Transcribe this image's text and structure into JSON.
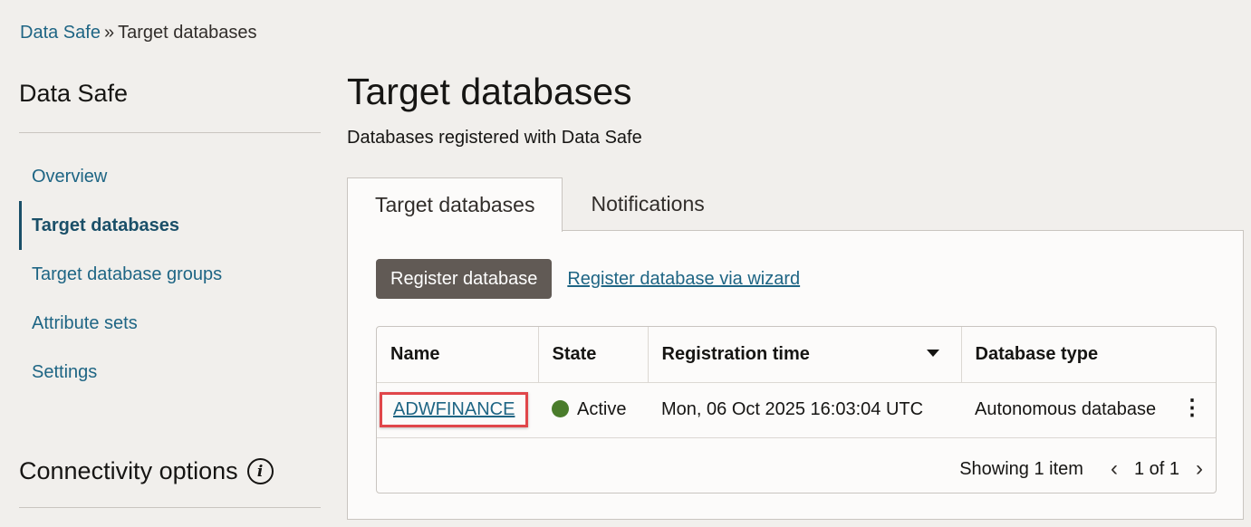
{
  "breadcrumb": {
    "parent": "Data Safe",
    "separator": "»",
    "current": "Target databases"
  },
  "sidebar": {
    "title": "Data Safe",
    "items": [
      {
        "label": "Overview",
        "active": false
      },
      {
        "label": "Target databases",
        "active": true
      },
      {
        "label": "Target database groups",
        "active": false
      },
      {
        "label": "Attribute sets",
        "active": false
      },
      {
        "label": "Settings",
        "active": false
      }
    ],
    "connectivity_title": "Connectivity options",
    "info_icon": "i"
  },
  "main": {
    "title": "Target databases",
    "subtitle": "Databases registered with Data Safe",
    "tabs": [
      {
        "label": "Target databases",
        "active": true
      },
      {
        "label": "Notifications",
        "active": false
      }
    ],
    "actions": {
      "register_button": "Register database",
      "wizard_link": "Register database via wizard"
    },
    "table": {
      "columns": [
        "Name",
        "State",
        "Registration time",
        "Database type"
      ],
      "rows": [
        {
          "name": "ADWFINANCE",
          "state": "Active",
          "registration_time": "Mon, 06 Oct 2025 16:03:04 UTC",
          "database_type": "Autonomous database",
          "menu_icon": "⋮"
        }
      ]
    },
    "pagination": {
      "summary": "Showing 1 item",
      "page": "1 of 1",
      "prev_icon": "‹",
      "next_icon": "›"
    }
  },
  "colors": {
    "link": "#1e6584",
    "primary_button": "#615a55",
    "status_active": "#4a7c2b",
    "highlight": "#e0464a"
  }
}
